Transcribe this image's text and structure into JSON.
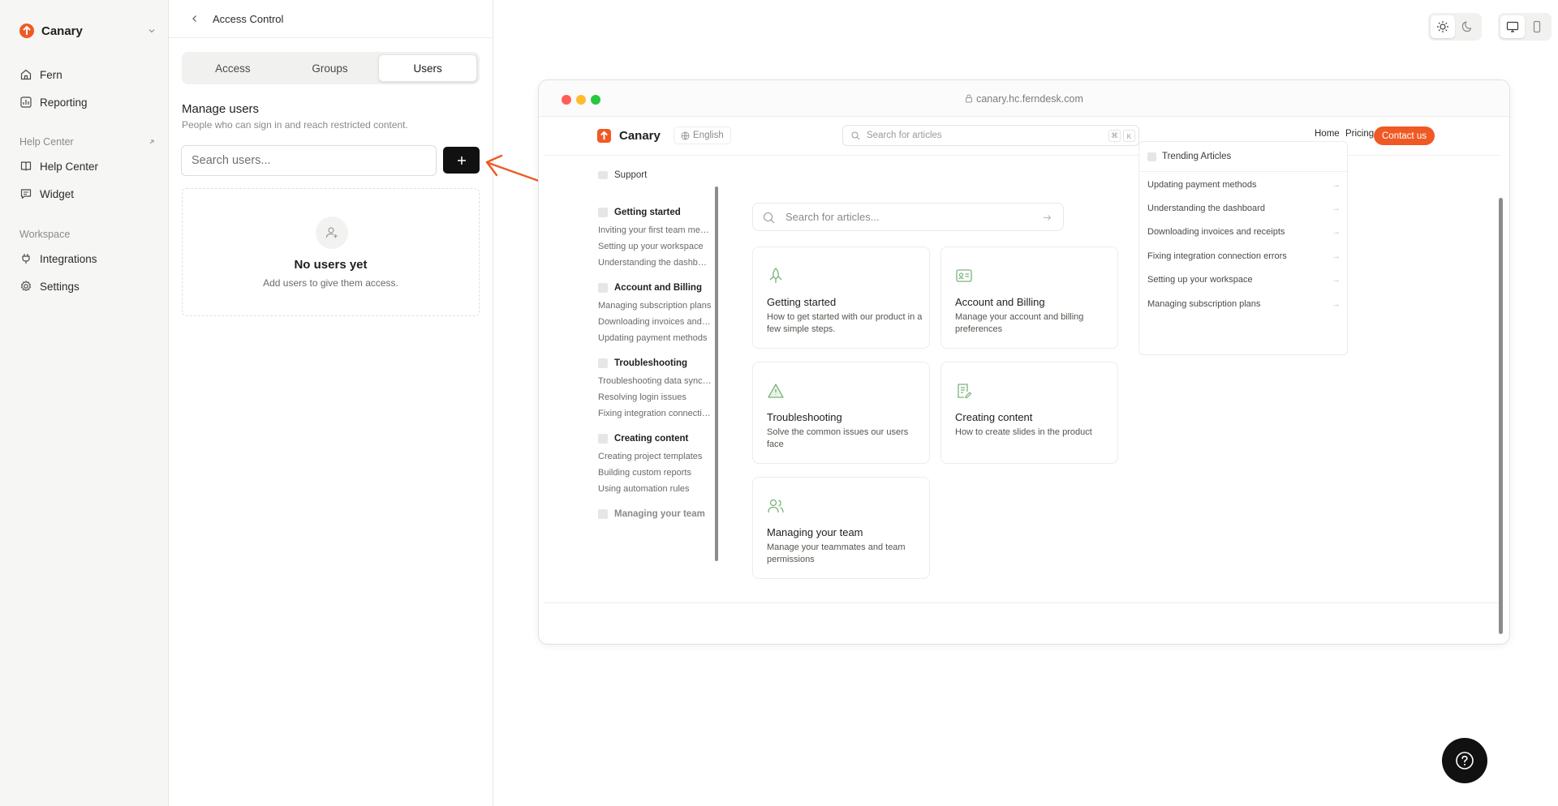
{
  "colors": {
    "brand": "#ef5a24",
    "accent_dark": "#111111",
    "icon_green": "#7ab27a"
  },
  "sidebar": {
    "workspace_name": "Canary",
    "items": [
      {
        "label": "Fern",
        "icon": "home-icon"
      },
      {
        "label": "Reporting",
        "icon": "chart-icon"
      }
    ],
    "help_center_section": "Help Center",
    "help_center_items": [
      {
        "label": "Help Center",
        "icon": "book-icon"
      },
      {
        "label": "Widget",
        "icon": "chat-icon"
      }
    ],
    "workspace_section": "Workspace",
    "workspace_items": [
      {
        "label": "Integrations",
        "icon": "plug-icon"
      },
      {
        "label": "Settings",
        "icon": "gear-icon"
      }
    ]
  },
  "access_panel": {
    "title": "Access Control",
    "tabs": [
      "Access",
      "Groups",
      "Users"
    ],
    "active_tab": "Users",
    "manage_title": "Manage users",
    "manage_subtitle": "People who can sign in and reach restricted content.",
    "search_placeholder": "Search users...",
    "empty_title": "No users yet",
    "empty_subtitle": "Add users to give them access."
  },
  "toggles": {
    "theme": [
      "light",
      "dark"
    ],
    "theme_selected": "light",
    "device": [
      "desktop",
      "mobile"
    ],
    "device_selected": "desktop"
  },
  "preview": {
    "url": "canary.hc.ferndesk.com",
    "brand": "Canary",
    "language": "English",
    "search_placeholder": "Search for articles",
    "kbd": [
      "⌘",
      "K"
    ],
    "nav": [
      "Home",
      "Pricing"
    ],
    "contact": "Contact us",
    "sidebar": {
      "support": "Support",
      "categories": [
        {
          "title": "Getting started",
          "links": [
            "Inviting your first team members",
            "Setting up your workspace",
            "Understanding the dashboard"
          ]
        },
        {
          "title": "Account and Billing",
          "links": [
            "Managing subscription plans",
            "Downloading invoices and receipts",
            "Updating payment methods"
          ]
        },
        {
          "title": "Troubleshooting",
          "links": [
            "Troubleshooting data sync delays",
            "Resolving login issues",
            "Fixing integration connection errors"
          ]
        },
        {
          "title": "Creating content",
          "links": [
            "Creating project templates",
            "Building custom reports",
            "Using automation rules"
          ]
        },
        {
          "title": "Managing your team",
          "links": []
        }
      ]
    },
    "article_search_placeholder": "Search for articles...",
    "cards": [
      {
        "title": "Getting started",
        "desc": "How to get started with our product in a few simple steps.",
        "icon": "rocket-icon"
      },
      {
        "title": "Account and Billing",
        "desc": "Manage your account and billing preferences",
        "icon": "id-card-icon"
      },
      {
        "title": "Troubleshooting",
        "desc": "Solve the common issues our users face",
        "icon": "warning-icon"
      },
      {
        "title": "Creating content",
        "desc": "How to create slides in the product",
        "icon": "document-edit-icon"
      },
      {
        "title": "Managing your team",
        "desc": "Manage your teammates and team permissions",
        "icon": "users-icon"
      }
    ],
    "trending": {
      "title": "Trending Articles",
      "items": [
        "Updating payment methods",
        "Understanding the dashboard",
        "Downloading invoices and receipts",
        "Fixing integration connection errors",
        "Setting up your workspace",
        "Managing subscription plans"
      ]
    }
  }
}
